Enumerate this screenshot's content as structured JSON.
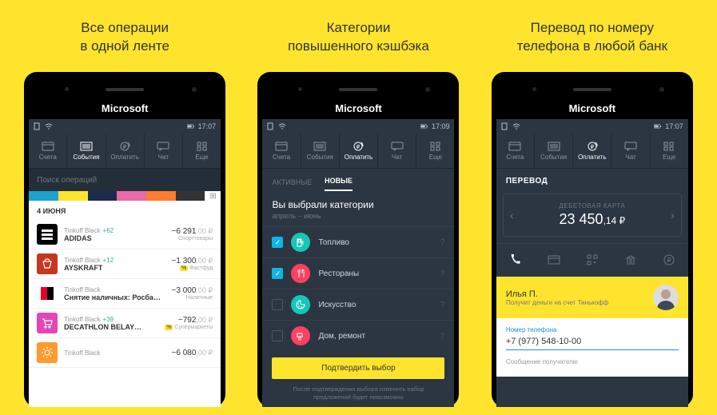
{
  "headings": [
    "Все операции\nв одной ленте",
    "Категории\nповышенного кэшбэка",
    "Перевод по номеру\nтелефона в любой банк"
  ],
  "brand": "Microsoft",
  "statusbar": {
    "time1": "17:07",
    "time2": "17:09",
    "time3": "17:07"
  },
  "toolbar": {
    "items": [
      {
        "label": "Счета"
      },
      {
        "label": "События"
      },
      {
        "label": "Оплатить"
      },
      {
        "label": "Чат"
      },
      {
        "label": "Еще"
      }
    ]
  },
  "screen1": {
    "search_placeholder": "Поиск операций",
    "colors": [
      "#1aa3cc",
      "#ffe42d",
      "#1b2c4a",
      "#e86aa6",
      "#ff7b2e",
      "#333"
    ],
    "date_header": "4 ИЮНЯ",
    "txns": [
      {
        "card": "Tinkoff Black",
        "bonus": "+62",
        "title": "ADIDAS",
        "amount": "−6 291",
        "dec": ",00 ₽",
        "cat": "Спорттовары",
        "ico_bg": "#000",
        "ico_style": "bars"
      },
      {
        "card": "Tinkoff Black",
        "bonus": "+12",
        "title": "AYSKRAFT",
        "amount": "−1 300",
        "dec": ",00 ₽",
        "cat": "Фастфуд",
        "badge": "%",
        "ico_bg": "#c7361f",
        "ico_style": "cup"
      },
      {
        "card": "Tinkoff Black",
        "bonus": "",
        "title": "Снятие наличных: Росба…",
        "amount": "−3 000",
        "dec": ",00 ₽",
        "cat": "Наличные",
        "ico_bg": "#fff",
        "ico_style": "sg"
      },
      {
        "card": "Tinkoff Black",
        "bonus": "+39",
        "title": "DECATHLON BELAY…",
        "amount": "−792",
        "dec": ",00 ₽",
        "cat": "Супермаркеты",
        "badge": "%",
        "ico_bg": "#e346b8",
        "ico_style": "cart"
      },
      {
        "card": "Tinkoff Black",
        "bonus": "",
        "title": "",
        "amount": "−6 080",
        "dec": ",00 ₽",
        "cat": "",
        "ico_bg": "#ff9a2e",
        "ico_style": "sun"
      }
    ]
  },
  "screen2": {
    "tab_active": "АКТИВНЫЕ",
    "tab_new": "НОВЫЕ",
    "title": "Вы выбрали категории",
    "subtitle": "апрель – июнь",
    "cats": [
      {
        "name": "Топливо",
        "checked": true,
        "color": "#17c6b5"
      },
      {
        "name": "Рестораны",
        "checked": true,
        "color": "#ff4060"
      },
      {
        "name": "Искусство",
        "checked": false,
        "color": "#17c6b5"
      },
      {
        "name": "Дом, ремонт",
        "checked": false,
        "color": "#ff4060"
      }
    ],
    "confirm": "Подтвердить выбор",
    "note": "После подтверждения выбора изменить набор предложений будет невозможно"
  },
  "screen3": {
    "header": "ПЕРЕВОД",
    "card_label": "ДЕБЕТОВАЯ КАРТА",
    "card_amount": "23 450",
    "card_dec": ",14 ₽",
    "recipient_name": "Илья П.",
    "recipient_sub": "Получит деньги на счет Тинькофф",
    "phone_label": "Номер телефона",
    "phone_value": "+7 (977) 548-10-00",
    "msg_label": "Сообщение получателю"
  }
}
